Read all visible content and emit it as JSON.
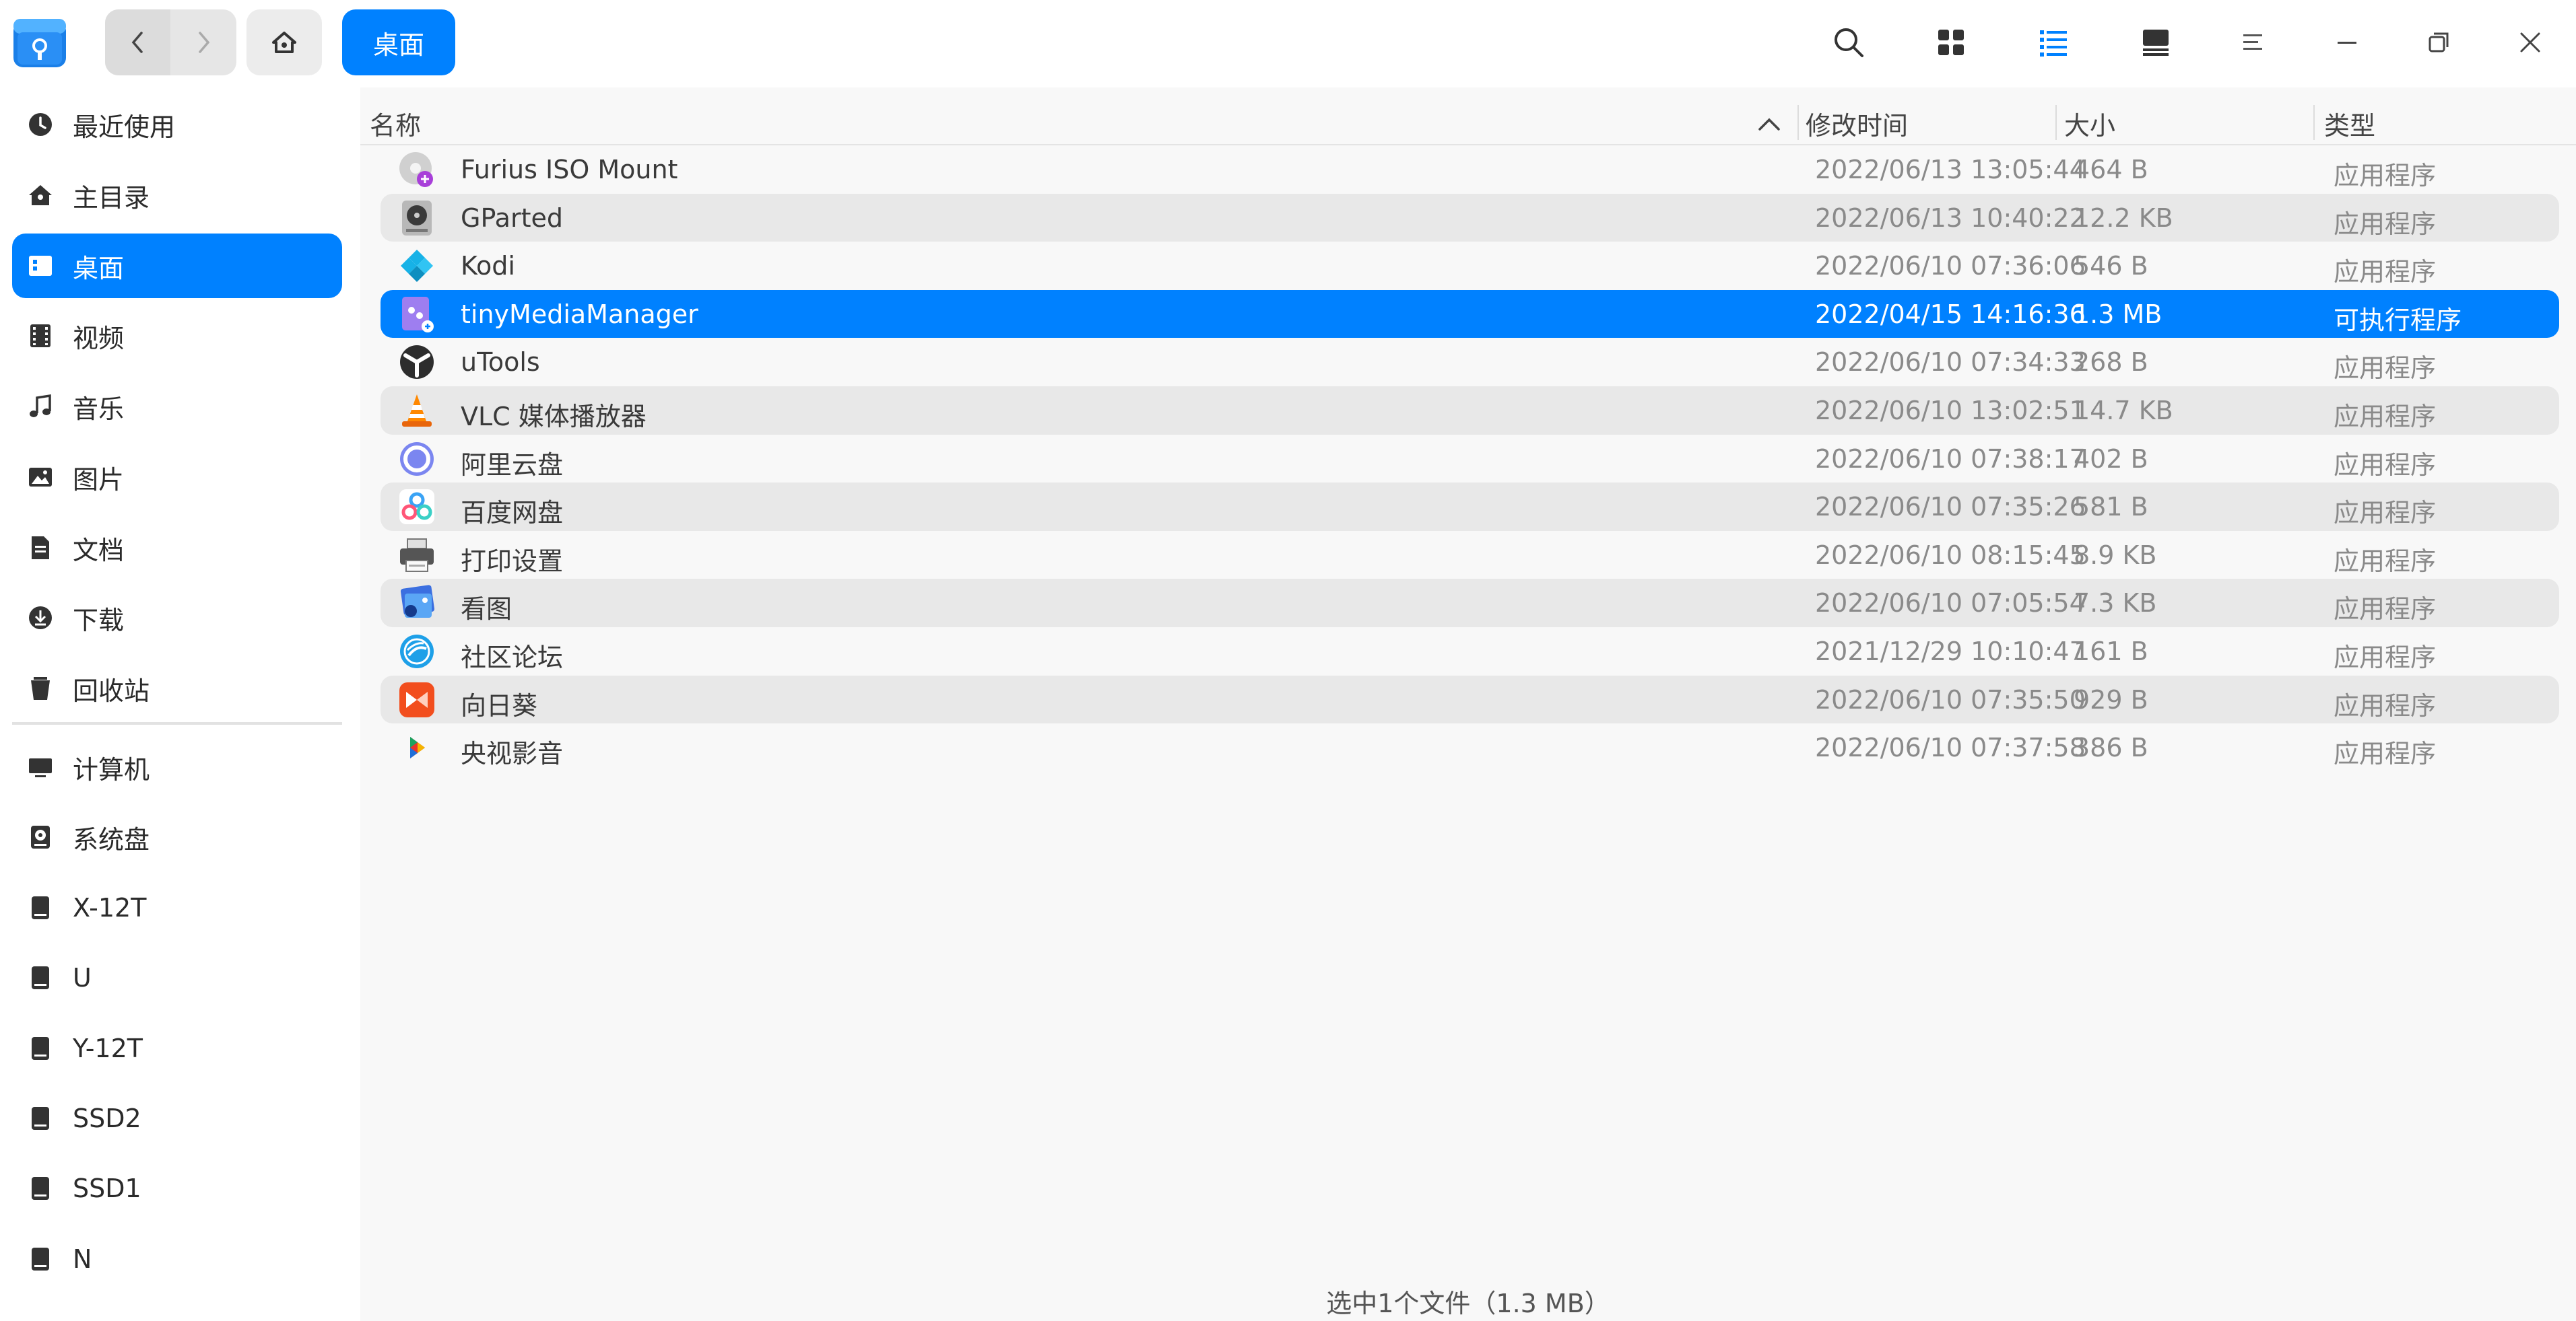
{
  "crumb": {
    "label": "桌面"
  },
  "sidebar": {
    "items": [
      {
        "label": "最近使用",
        "icon": "clock-icon"
      },
      {
        "label": "主目录",
        "icon": "home-icon"
      },
      {
        "label": "桌面",
        "icon": "desktop-icon"
      },
      {
        "label": "视频",
        "icon": "film-icon"
      },
      {
        "label": "音乐",
        "icon": "music-icon"
      },
      {
        "label": "图片",
        "icon": "image-icon"
      },
      {
        "label": "文档",
        "icon": "document-icon"
      },
      {
        "label": "下载",
        "icon": "download-icon"
      },
      {
        "label": "回收站",
        "icon": "trash-icon"
      }
    ],
    "devices": [
      {
        "label": "计算机",
        "icon": "computer-icon"
      },
      {
        "label": "系统盘",
        "icon": "system-disk-icon"
      },
      {
        "label": "X-12T",
        "icon": "drive-icon"
      },
      {
        "label": "U",
        "icon": "drive-icon"
      },
      {
        "label": "Y-12T",
        "icon": "drive-icon"
      },
      {
        "label": "SSD2",
        "icon": "drive-icon"
      },
      {
        "label": "SSD1",
        "icon": "drive-icon"
      },
      {
        "label": "N",
        "icon": "drive-icon"
      }
    ]
  },
  "columns": {
    "name": "名称",
    "modified": "修改时间",
    "size": "大小",
    "type": "类型"
  },
  "files": [
    {
      "name": "Furius ISO Mount",
      "modified": "2022/06/13 13:05:44",
      "size": "464 B",
      "type": "应用程序",
      "icon": "disc-mount-icon"
    },
    {
      "name": "GParted",
      "modified": "2022/06/13 10:40:22",
      "size": "12.2 KB",
      "type": "应用程序",
      "icon": "partition-disk-icon"
    },
    {
      "name": "Kodi",
      "modified": "2022/06/10 07:36:06",
      "size": "546 B",
      "type": "应用程序",
      "icon": "kodi-icon"
    },
    {
      "name": "tinyMediaManager",
      "modified": "2022/04/15 14:16:36",
      "size": "1.3 MB",
      "type": "可执行程序",
      "icon": "executable-icon"
    },
    {
      "name": "uTools",
      "modified": "2022/06/10 07:34:33",
      "size": "268 B",
      "type": "应用程序",
      "icon": "utools-icon"
    },
    {
      "name": "VLC 媒体播放器",
      "modified": "2022/06/10 13:02:51",
      "size": "14.7 KB",
      "type": "应用程序",
      "icon": "vlc-cone-icon"
    },
    {
      "name": "阿里云盘",
      "modified": "2022/06/10 07:38:17",
      "size": "402 B",
      "type": "应用程序",
      "icon": "aliyun-drive-icon"
    },
    {
      "name": "百度网盘",
      "modified": "2022/06/10 07:35:26",
      "size": "581 B",
      "type": "应用程序",
      "icon": "baidu-netdisk-icon"
    },
    {
      "name": "打印设置",
      "modified": "2022/06/10 08:15:45",
      "size": "8.9 KB",
      "type": "应用程序",
      "icon": "printer-icon"
    },
    {
      "name": "看图",
      "modified": "2022/06/10 07:05:54",
      "size": "7.3 KB",
      "type": "应用程序",
      "icon": "image-viewer-icon"
    },
    {
      "name": "社区论坛",
      "modified": "2021/12/29 10:10:47",
      "size": "161 B",
      "type": "应用程序",
      "icon": "deepin-forum-icon"
    },
    {
      "name": "向日葵",
      "modified": "2022/06/10 07:35:50",
      "size": "929 B",
      "type": "应用程序",
      "icon": "sunlogin-icon"
    },
    {
      "name": "央视影音",
      "modified": "2022/06/10 07:37:58",
      "size": "386 B",
      "type": "应用程序",
      "icon": "cctv-video-icon"
    }
  ],
  "selected_index": 3,
  "status": {
    "text": "选中1个文件（1.3 MB）"
  },
  "colors": {
    "accent": "#0081ff",
    "sidebar_bg": "#ffffff",
    "list_bg": "#f8f8f8",
    "alt_row": "#e8e8e8"
  }
}
